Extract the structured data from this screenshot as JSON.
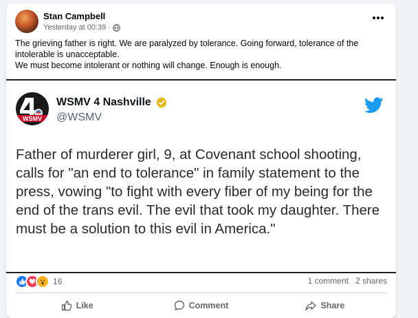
{
  "post": {
    "author": "Stan Campbell",
    "timestamp": "Yesterday at 00:39",
    "separator": "·",
    "audience_icon": "globe-icon",
    "text_line1": "The grieving father is right. We are paralyzed by tolerance. Going forward, tolerance of the intolerable is unacceptable.",
    "text_line2": "We must become intolerant or nothing will change. Enough is enough."
  },
  "embed": {
    "account_name": "WSMV 4 Nashville",
    "handle": "@WSMV",
    "logo_text": "WSMV",
    "verified_icon": "verified-badge-icon",
    "platform_icon": "twitter-bird-icon",
    "tweet_text": "Father of murderer girl, 9, at Covenant school shooting, calls for \"an end to tolerance\" in family statement to the press, vowing \"to fight with every fiber of my being for the end of the trans evil. The evil that took my daughter. There must be a solution to this evil in America.\""
  },
  "engagement": {
    "reaction_icons": [
      "like-reaction-icon",
      "love-reaction-icon",
      "wow-reaction-icon"
    ],
    "reaction_count": "16",
    "comments": "1 comment",
    "shares": "2 shares"
  },
  "actions": {
    "like": "Like",
    "comment": "Comment",
    "share": "Share"
  },
  "colors": {
    "facebook_blue": "#1877f2",
    "love_red": "#f33e58",
    "wow_yellow": "#f7b125",
    "twitter_blue": "#1d9bf0",
    "verified_gold": "#e2b719"
  }
}
